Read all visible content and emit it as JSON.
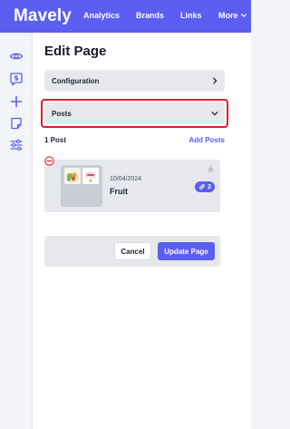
{
  "nav": {
    "logo": "Mavely",
    "links": [
      "Analytics",
      "Brands",
      "Links",
      "More"
    ]
  },
  "sidebar": {
    "icons": [
      "eye-icon",
      "dollar-chat-icon",
      "plus-icon",
      "note-icon",
      "sliders-icon"
    ]
  },
  "page": {
    "title": "Edit Page"
  },
  "sections": {
    "configuration": "Configuration",
    "posts": "Posts"
  },
  "posts": {
    "count_label": "1 Post",
    "add_label": "Add Posts",
    "items": [
      {
        "date": "10/04/2024",
        "title": "Fruit",
        "link_count": "2"
      }
    ]
  },
  "actions": {
    "cancel": "Cancel",
    "update": "Update Page"
  },
  "colors": {
    "brand": "#5b5ef0",
    "highlight": "#e01e2b"
  }
}
